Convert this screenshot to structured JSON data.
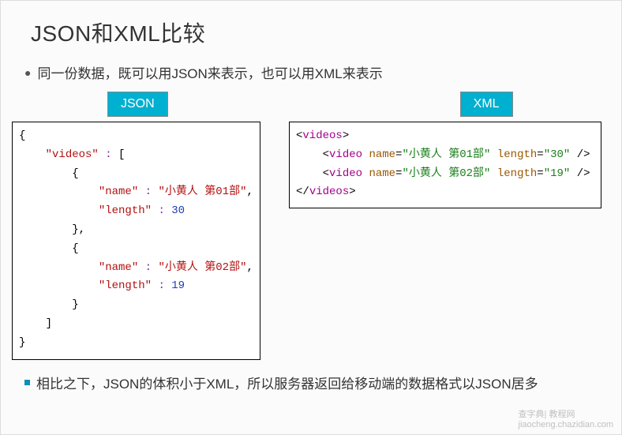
{
  "title": "JSON和XML比较",
  "bullet1": "同一份数据，既可以用JSON来表示，也可以用XML来表示",
  "badge_json": "JSON",
  "badge_xml": "XML",
  "json_code": {
    "key_videos": "\"videos\"",
    "key_name": "\"name\"",
    "key_length": "\"length\"",
    "val_name1": "\"小黄人 第01部\"",
    "val_len1": "30",
    "val_name2": "\"小黄人 第02部\"",
    "val_len2": "19"
  },
  "xml_code": {
    "open": "videos",
    "item_tag": "video",
    "attr_name": "name",
    "attr_length": "length",
    "name1": "\"小黄人 第01部\"",
    "len1": "\"30\"",
    "name2": "\"小黄人 第02部\"",
    "len2": "\"19\""
  },
  "bullet2": "相比之下，JSON的体积小于XML，所以服务器返回给移动端的数据格式以JSON居多",
  "watermark": {
    "left": "查字典",
    "right": "教程网",
    "url": "jiaocheng.chazidian.com"
  },
  "colors": {
    "badge_bg": "#00b0d0",
    "accent_square": "#0d8fb5"
  }
}
